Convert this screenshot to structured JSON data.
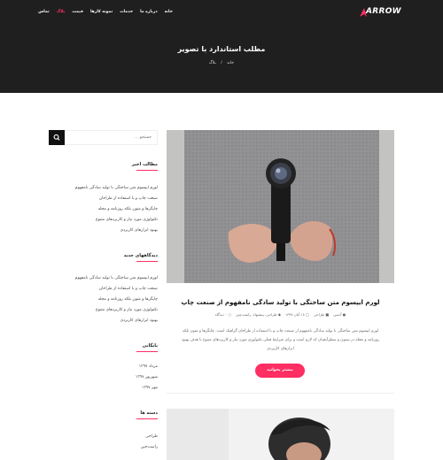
{
  "brand": {
    "logo_text": "ARROW"
  },
  "nav": {
    "items": [
      {
        "label": "خانه"
      },
      {
        "label": "درباره ما"
      },
      {
        "label": "خدمات"
      },
      {
        "label": "نمونه کارها"
      },
      {
        "label": "قیمت"
      },
      {
        "label": "بلاگ",
        "active": true
      },
      {
        "label": "تماس"
      }
    ]
  },
  "page": {
    "title": "مطلب استاندارد با تصویر"
  },
  "breadcrumb": {
    "home": "خانه",
    "separator": "/",
    "current": "بلاگ"
  },
  "sidebar": {
    "search_placeholder": "جستجو ...",
    "recent_posts": {
      "title": "مطالب اخیر",
      "items": [
        "لورم ایپسوم متن ساختگی با تولید سادگی نامفهوم",
        "صنعت چاپ و با استفاده از طراحان",
        "چاپگرها و متون بلکه روزنامه و مجله",
        "تکنولوژی مورد نیاز و کاربردهای متنوع",
        "بهبود ابزارهای کاربردی"
      ]
    },
    "recent_comments": {
      "title": "دیدگاههای جدید",
      "items": [
        "لورم ایپسوم متن ساختگی با تولید سادگی نامفهوم",
        "صنعت چاپ و با استفاده از طراحان",
        "چاپگرها و متون بلکه روزنامه و مجله",
        "تکنولوژی مورد نیاز و کاربردهای متنوع",
        "بهبود ابزارهای کاربردی"
      ]
    },
    "archives": {
      "title": "بایگانی",
      "items": [
        "مرداد ۱۳۹۷",
        "شهریور ۱۳۹۷",
        "مهر ۱۳۹۷"
      ]
    },
    "categories": {
      "title": "دسته ها",
      "items": [
        "طراحی",
        "راست‌چین"
      ]
    }
  },
  "post": {
    "title": "لورم ایپسوم متن ساختگی با تولید سادگی نامفهوم از صنعت چاپ",
    "meta": {
      "author": "آدمین",
      "category": "طراحی",
      "date": "۱۸ آبان ۱۳۹۷",
      "tags": "طراحی، پیشنهاد، راست‌چین",
      "comments": "۰ دیدگاه"
    },
    "excerpt": "لورم ایپسوم متن ساختگی با تولید سادگی نامفهوم از صنعت چاپ و با استفاده از طراحان گرافیک است. چاپگرها و متون بلکه روزنامه و مجله در ستون و سطرآنچنان که لازم است و برای شرایط فعلی تکنولوژی مورد نیاز و کاربردهای متنوع با هدف بهبود ابزارهای کاربردی",
    "read_more": "بیشتر بخوانید"
  },
  "colors": {
    "accent": "#ff2e63",
    "hero_bg": "#1f1f1f"
  }
}
